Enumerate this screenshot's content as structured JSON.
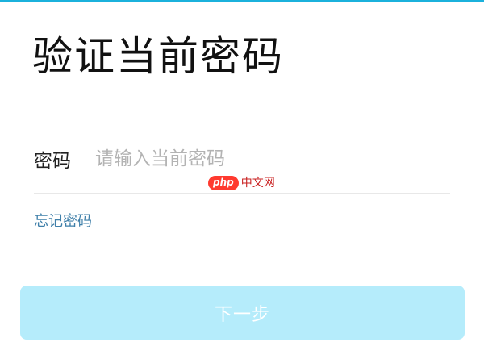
{
  "page": {
    "title": "验证当前密码",
    "accent_color": "#1bb1dc"
  },
  "form": {
    "password_label": "密码",
    "password_value": "",
    "password_placeholder": "请输入当前密码",
    "forgot_label": "忘记密码",
    "next_label": "下一步",
    "next_button_color": "#b5ecfb",
    "link_color": "#3f7fa9"
  },
  "watermark": {
    "badge_text": "php",
    "site_text": "中文网",
    "badge_color": "#ff3a2f"
  }
}
